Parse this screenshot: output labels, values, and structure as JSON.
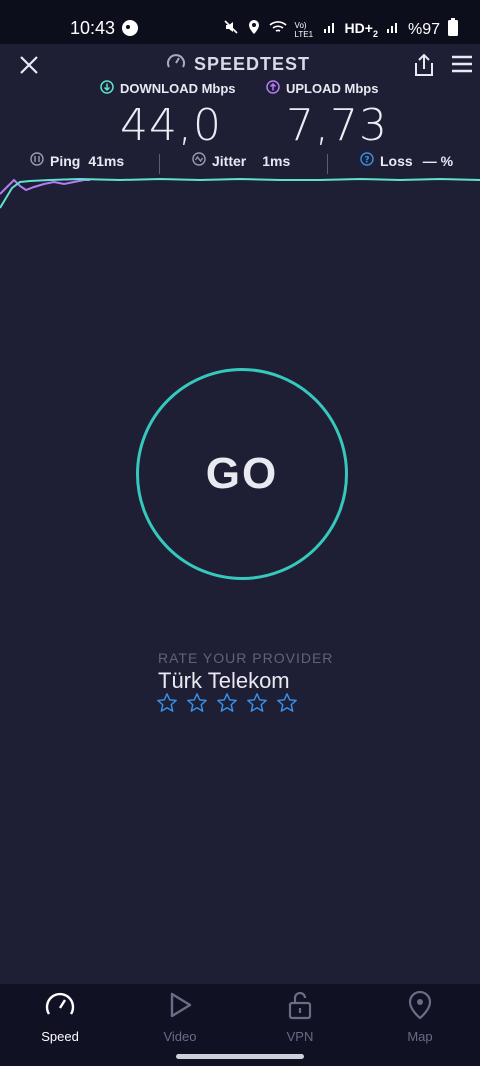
{
  "status": {
    "time": "10:43",
    "network_text": "Vo) LTE1",
    "hd_text": "HD+",
    "hd_sub": "2",
    "battery": "%97"
  },
  "header": {
    "title": "SPEEDTEST"
  },
  "download": {
    "label": "DOWNLOAD Mbps",
    "value": "44,0",
    "color": "#5fe0d0"
  },
  "upload": {
    "label": "UPLOAD Mbps",
    "value": "7,73",
    "color": "#b57cf4"
  },
  "stats": {
    "ping": {
      "label": "Ping",
      "value": "41ms"
    },
    "jitter": {
      "label": "Jitter",
      "value": "1ms"
    },
    "loss": {
      "label": "Loss",
      "value": "— %"
    }
  },
  "go": {
    "label": "GO"
  },
  "rate": {
    "caption": "RATE YOUR PROVIDER",
    "provider": "Türk Telekom",
    "stars": 0,
    "max_stars": 5
  },
  "tabs": [
    {
      "label": "Speed",
      "icon": "speedometer-icon",
      "active": true
    },
    {
      "label": "Video",
      "icon": "play-icon",
      "active": false
    },
    {
      "label": "VPN",
      "icon": "lock-icon",
      "active": false
    },
    {
      "label": "Map",
      "icon": "map-pin-icon",
      "active": false
    }
  ],
  "colors": {
    "background": "#1e1f34",
    "accent_teal": "#36c8bc",
    "star_blue": "#3a8fe8",
    "inactive_tab": "#6a6c88"
  }
}
